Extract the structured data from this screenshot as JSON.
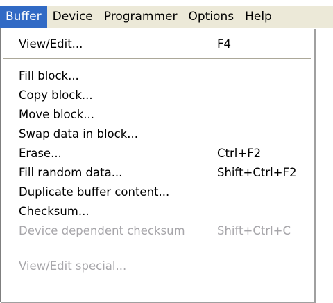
{
  "menubar": {
    "items": [
      "Buffer",
      "Device",
      "Programmer",
      "Options",
      "Help"
    ],
    "active": "Buffer"
  },
  "buffer_menu": {
    "view_edit": {
      "label": "View/Edit...",
      "shortcut": "F4"
    },
    "fill_block": {
      "label": "Fill block..."
    },
    "copy_block": {
      "label": "Copy block..."
    },
    "move_block": {
      "label": "Move block..."
    },
    "swap_data": {
      "label": "Swap data in block..."
    },
    "erase": {
      "label": "Erase...",
      "shortcut": "Ctrl+F2"
    },
    "fill_random": {
      "label": "Fill random data...",
      "shortcut": "Shift+Ctrl+F2"
    },
    "duplicate": {
      "label": "Duplicate buffer content..."
    },
    "checksum": {
      "label": "Checksum..."
    },
    "device_checksum": {
      "label": "Device dependent checksum",
      "shortcut": "Shift+Ctrl+C",
      "enabled": false
    },
    "view_edit_special": {
      "label": "View/Edit special...",
      "enabled": false
    }
  },
  "colors": {
    "menubar_bg": "#ece9d8",
    "highlight": "#316ac5",
    "disabled_text": "#a7a6aa"
  }
}
